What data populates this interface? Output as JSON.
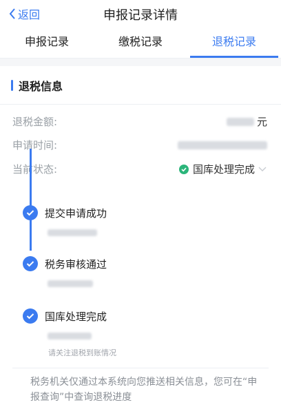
{
  "nav": {
    "back_label": "返回",
    "title": "申报记录详情"
  },
  "tabs": [
    {
      "label": "申报记录"
    },
    {
      "label": "缴税记录"
    },
    {
      "label": "退税记录"
    }
  ],
  "section": {
    "title": "退税信息"
  },
  "fields": {
    "amount_label": "退税金额:",
    "amount_suffix": "元",
    "time_label": "申请时间:",
    "status_label": "当前状态:",
    "status_value": "国库处理完成"
  },
  "timeline": [
    {
      "title": "提交申请成功"
    },
    {
      "title": "税务审核通过"
    },
    {
      "title": "国库处理完成"
    }
  ],
  "hint": "请关注退税到账情况",
  "notice": "税务机关仅通过本系统向您推送相关信息，您可在“申报查询”中查询退税进度",
  "colors": {
    "accent": "#3b7bf0",
    "success": "#2bb57a"
  }
}
